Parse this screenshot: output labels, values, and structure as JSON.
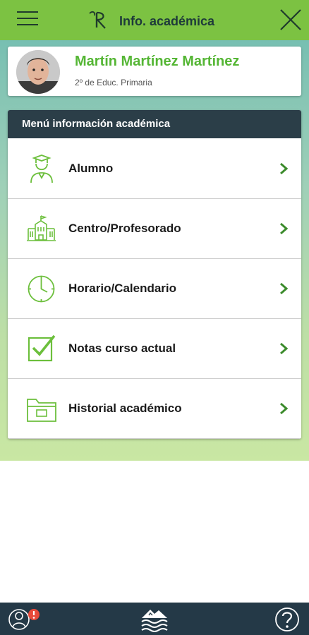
{
  "header": {
    "title": "Info. académica",
    "menu_icon": "hamburger-menu-icon",
    "logo_icon": "raices-logo-icon",
    "close_icon": "close-icon"
  },
  "student": {
    "name": "Martín Martínez Martínez",
    "grade": "2º de Educ. Primaria"
  },
  "menu": {
    "heading": "Menú información académica",
    "items": [
      {
        "label": "Alumno",
        "icon": "student-icon"
      },
      {
        "label": "Centro/Profesorado",
        "icon": "school-building-icon"
      },
      {
        "label": "Horario/Calendario",
        "icon": "clock-icon"
      },
      {
        "label": "Notas curso actual",
        "icon": "checkbox-icon"
      },
      {
        "label": "Historial académico",
        "icon": "folder-icon"
      }
    ]
  },
  "bottom_nav": {
    "user_icon": "user-alert-icon",
    "home_icon": "home-landscape-icon",
    "help_icon": "help-icon"
  },
  "colors": {
    "accent_green": "#7cc242",
    "name_green": "#55b635",
    "dark_header": "#2b3e48",
    "alert_red": "#e84a3a"
  }
}
